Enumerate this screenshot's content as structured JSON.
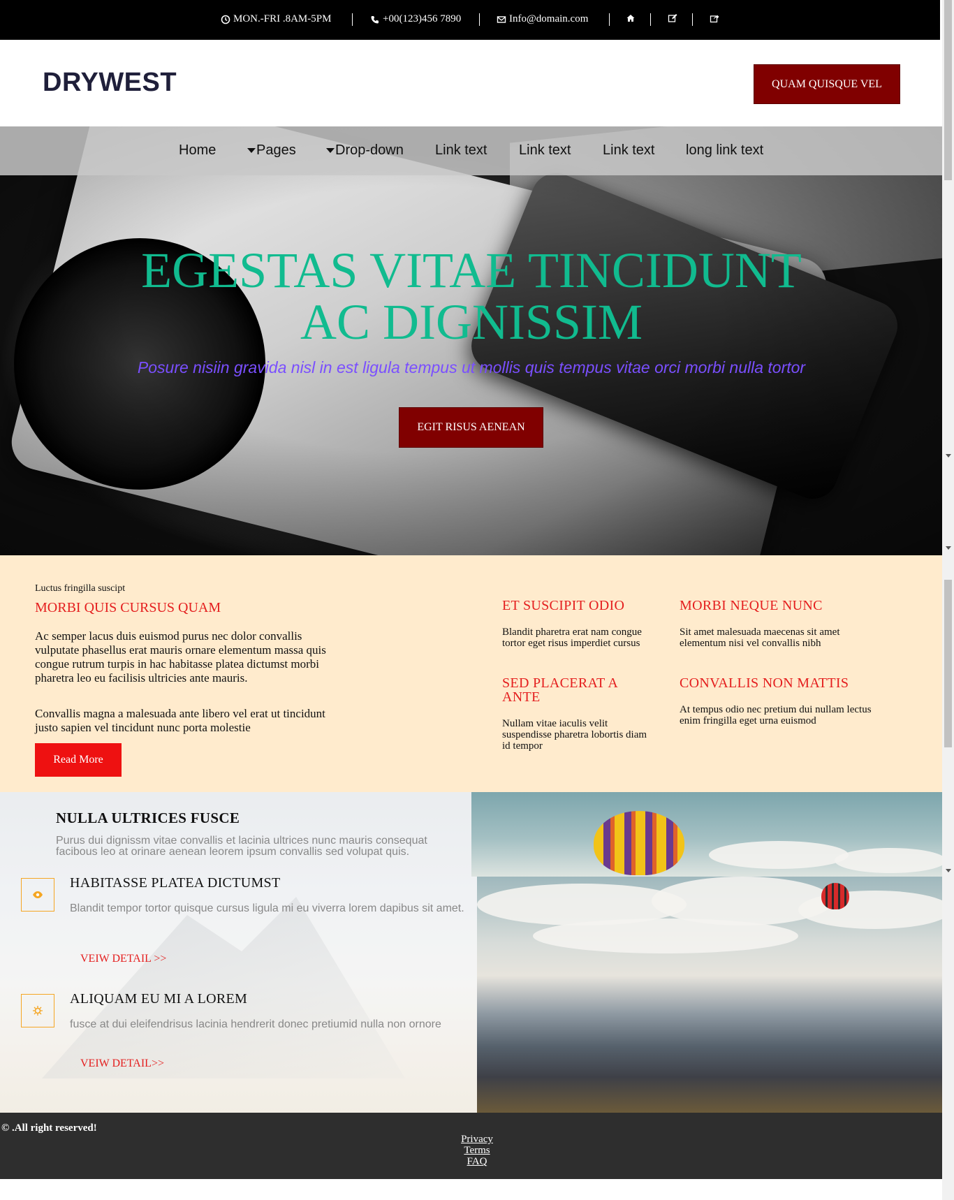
{
  "topbar": {
    "hours": "MON.-FRI .8AM-5PM",
    "phone": "+00(123)456 7890",
    "email": "Info@domain.com",
    "icons": [
      "clock-icon",
      "phone-icon",
      "envelope-icon",
      "home-icon",
      "edit-icon",
      "share-icon"
    ]
  },
  "header": {
    "logo": "DRYWEST",
    "cta_label": "QUAM QUISQUE VEL"
  },
  "nav": {
    "items": [
      {
        "label": "Home",
        "dropdown": false
      },
      {
        "label": "Pages",
        "dropdown": true
      },
      {
        "label": "Drop-down",
        "dropdown": true
      },
      {
        "label": "Link text",
        "dropdown": false
      },
      {
        "label": "Link text",
        "dropdown": false
      },
      {
        "label": "Link text",
        "dropdown": false
      },
      {
        "label": "long link text",
        "dropdown": false
      }
    ]
  },
  "hero": {
    "title_line1": "EGESTAS VITAE TINCIDUNT",
    "title_line2": "AC DIGNISSIM",
    "subtitle": "Posure nisiin gravida nisl in est ligula tempus ut mollis quis tempus vitae orci morbi nulla tortor",
    "button_label": "EGIT RISUS AENEAN"
  },
  "features": {
    "small_label": "Luctus fringilla suscipt",
    "heading": "MORBI QUIS CURSUS QUAM",
    "paragraph1": "Ac semper lacus duis euismod purus nec dolor convallis vulputate phasellus erat mauris ornare elementum massa quis congue rutrum turpis in hac habitasse platea dictumst morbi pharetra leo eu facilisis ultricies ante mauris.",
    "paragraph2": "Convallis magna a malesuada ante libero vel erat ut tincidunt justo sapien vel tincidunt nunc porta molestie",
    "button_label": "Read More",
    "items": [
      {
        "title": "ET SUSCIPIT ODIO",
        "text": "Blandit pharetra erat nam congue tortor eget risus imperdiet cursus"
      },
      {
        "title": "MORBI NEQUE NUNC",
        "text": "Sit amet malesuada maecenas sit amet elementum nisi vel convallis nibh"
      },
      {
        "title": "SED PLACERAT A ANTE",
        "text": "Nullam vitae iaculis velit suspendisse pharetra lobortis diam id tempor"
      },
      {
        "title": "CONVALLIS NON MATTIS",
        "text": "At tempus odio nec pretium dui nullam lectus enim fringilla eget urna euismod"
      }
    ]
  },
  "services": {
    "title": "NULLA ULTRICES FUSCE",
    "description": "Purus dui dignissm vitae convallis et lacinia ultrices nunc mauris consequat facibous leo at orinare aenean leorem ipsum convallis sed volupat quis.",
    "items": [
      {
        "icon": "eye-icon",
        "title": "HABITASSE PLATEA DICTUMST",
        "text": "Blandit tempor tortor quisque cursus ligula mi eu viverra lorem dapibus sit amet.",
        "link": "VEIW DETAIL >>"
      },
      {
        "icon": "sun-icon",
        "title": "ALIQUAM EU MI A LOREM",
        "text": "fusce at dui eleifendrisus lacinia hendrerit donec pretiumid nulla non ornore",
        "link": "VEIW DETAIL>>"
      }
    ]
  },
  "footer": {
    "copyright": "© .All right reserved!",
    "links": [
      "Privacy",
      "Terms",
      "FAQ"
    ]
  },
  "colors": {
    "maroon": "#800000",
    "accent_red": "#e41e1e",
    "hero_title": "#11bb8f",
    "hero_sub": "#7a4fff",
    "features_bg": "#ffebcd",
    "icon_orange": "#f5a623"
  }
}
